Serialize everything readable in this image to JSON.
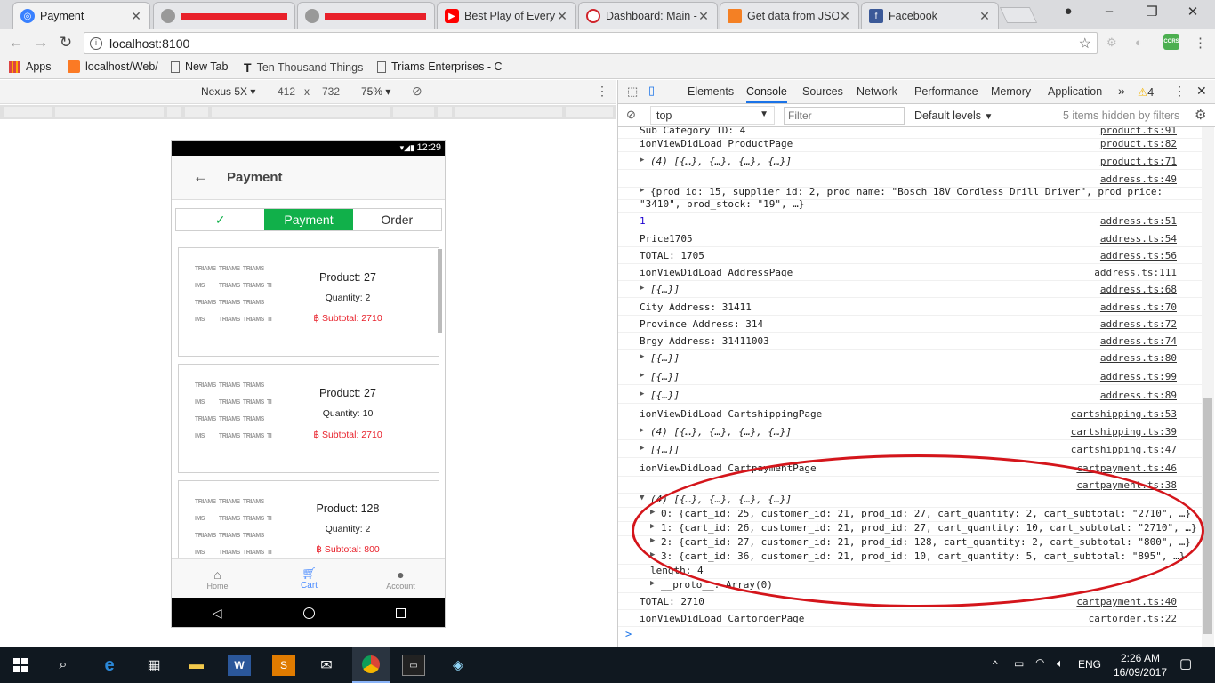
{
  "browser": {
    "tabs": [
      {
        "title": "Payment",
        "icon": "ionic-icon",
        "color": "#3880ff",
        "active": true
      },
      {
        "title": "",
        "icon": "page-icon",
        "color": "#888888",
        "redacted": true
      },
      {
        "title": "",
        "icon": "page-icon",
        "color": "#888888",
        "redacted": true
      },
      {
        "title": "Best Play of Every",
        "icon": "youtube-icon",
        "color": "#ff0000"
      },
      {
        "title": "Dashboard: Main -",
        "icon": "dashboard-icon",
        "color": "#d0242b"
      },
      {
        "title": "Get data from JSO",
        "icon": "stack-icon",
        "color": "#f48024"
      },
      {
        "title": "Facebook",
        "icon": "facebook-icon",
        "color": "#3b5998"
      }
    ],
    "url": "localhost:8100",
    "bookmarks": [
      "Apps",
      "localhost/Web/",
      "New Tab",
      "Ten Thousand Things",
      "Triams Enterprises - C"
    ]
  },
  "device_toolbar": {
    "device": "Nexus 5X",
    "width": "412",
    "times": "x",
    "height": "732",
    "zoom": "75%"
  },
  "app": {
    "status_time": "12:29",
    "title": "Payment",
    "segments": [
      "✓",
      "Payment",
      "Order"
    ],
    "cards": [
      {
        "product": "Product: 27",
        "quantity": "Quantity: 2",
        "subtotal": "Subtotal: 2710"
      },
      {
        "product": "Product: 27",
        "quantity": "Quantity: 10",
        "subtotal": "Subtotal: 2710"
      },
      {
        "product": "Product: 128",
        "quantity": "Quantity: 2",
        "subtotal": "Subtotal: 800"
      }
    ],
    "currency": "฿",
    "thumb_text": [
      "TRIAMS",
      "TRIAMS",
      "TRIAMS",
      "IMS",
      "TRIAMS",
      "TRIAMS",
      "TI"
    ],
    "footer_tabs": [
      "Home",
      "Cart",
      "Account"
    ]
  },
  "devtools": {
    "tabs": [
      "Elements",
      "Console",
      "Sources",
      "Network",
      "Performance",
      "Memory",
      "Application"
    ],
    "more": "»",
    "warnings": "4",
    "context": "top",
    "filter_placeholder": "Filter",
    "levels": "Default levels",
    "hidden": "5 items hidden by filters",
    "lines": [
      {
        "msg": "Sub Category ID: 4",
        "src": "product.ts:91"
      },
      {
        "msg": "ionViewDidLoad ProductPage",
        "src": "product.ts:82"
      },
      {
        "msg": "(4) [{…}, {…}, {…}, {…}]",
        "src": "product.ts:71",
        "tri": "▶",
        "italic": true
      },
      {
        "msg": "",
        "src": "address.ts:49"
      },
      {
        "msg": "{prod_id: 15, supplier_id: 2, prod_name: \"Bosch 18V Cordless Drill Driver\", prod_price:",
        "src": "",
        "tri": "▶"
      },
      {
        "msg": "\"3410\", prod_stock: \"19\", …}",
        "src": ""
      },
      {
        "msg": "1",
        "src": "address.ts:51"
      },
      {
        "msg": "Price1705",
        "src": "address.ts:54"
      },
      {
        "msg": "TOTAL: 1705",
        "src": "address.ts:56"
      },
      {
        "msg": "ionViewDidLoad AddressPage",
        "src": "address.ts:111"
      },
      {
        "msg": "[{…}]",
        "src": "address.ts:68",
        "tri": "▶",
        "italic": true
      },
      {
        "msg": "City Address: 31411",
        "src": "address.ts:70"
      },
      {
        "msg": "Province Address: 314",
        "src": "address.ts:72"
      },
      {
        "msg": "Brgy Address: 31411003",
        "src": "address.ts:74"
      },
      {
        "msg": "[{…}]",
        "src": "address.ts:80",
        "tri": "▶",
        "italic": true
      },
      {
        "msg": "[{…}]",
        "src": "address.ts:99",
        "tri": "▶",
        "italic": true
      },
      {
        "msg": "[{…}]",
        "src": "address.ts:89",
        "tri": "▶",
        "italic": true
      },
      {
        "msg": "ionViewDidLoad CartshippingPage",
        "src": "cartshipping.ts:53"
      },
      {
        "msg": "(4) [{…}, {…}, {…}, {…}]",
        "src": "cartshipping.ts:39",
        "tri": "▶",
        "italic": true
      },
      {
        "msg": "[{…}]",
        "src": "cartshipping.ts:47",
        "tri": "▶",
        "italic": true
      },
      {
        "msg": "ionViewDidLoad CartpaymentPage",
        "src": "cartpayment.ts:46"
      },
      {
        "msg": "",
        "src": "cartpayment.ts:38"
      },
      {
        "msg": "(4) [{…}, {…}, {…}, {…}]",
        "src": "",
        "tri": "▼",
        "italic": true
      },
      {
        "msg": "0: {cart_id: 25, customer_id: 21, prod_id: 27, cart_quantity: 2, cart_subtotal: \"2710\", …}",
        "src": "",
        "tri": "▶",
        "indent": true
      },
      {
        "msg": "1: {cart_id: 26, customer_id: 21, prod_id: 27, cart_quantity: 10, cart_subtotal: \"2710\", …}",
        "src": "",
        "tri": "▶",
        "indent": true
      },
      {
        "msg": "2: {cart_id: 27, customer_id: 21, prod_id: 128, cart_quantity: 2, cart_subtotal: \"800\", …}",
        "src": "",
        "tri": "▶",
        "indent": true
      },
      {
        "msg": "3: {cart_id: 36, customer_id: 21, prod_id: 10, cart_quantity: 5, cart_subtotal: \"895\", …}",
        "src": "",
        "tri": "▶",
        "indent": true
      },
      {
        "msg": "length: 4",
        "src": "",
        "indent": true
      },
      {
        "msg": "__proto__: Array(0)",
        "src": "",
        "tri": "▶",
        "indent": true
      },
      {
        "msg": "TOTAL: 2710",
        "src": "cartpayment.ts:40"
      },
      {
        "msg": "ionViewDidLoad CartorderPage",
        "src": "cartorder.ts:22"
      }
    ],
    "prompt": ">"
  },
  "taskbar": {
    "time": "2:26 AM",
    "date": "16/09/2017",
    "lang": "ENG"
  },
  "colors": {
    "accent_green": "#11b04a",
    "ionic_blue": "#488aff",
    "highlight_red": "#d4151b"
  }
}
